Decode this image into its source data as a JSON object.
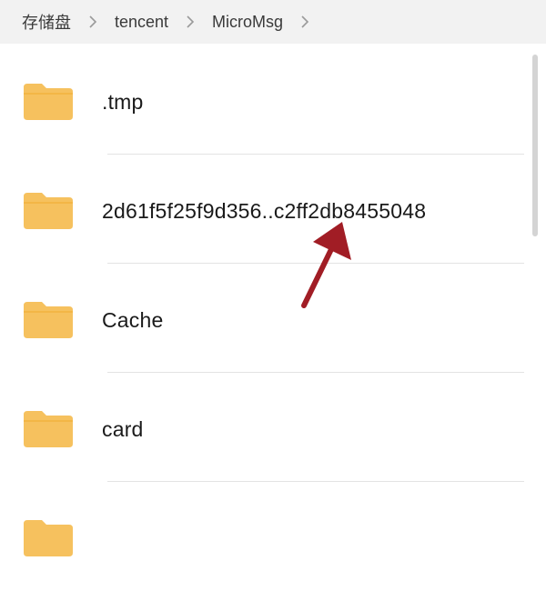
{
  "breadcrumb": {
    "items": [
      {
        "label": "存储盘"
      },
      {
        "label": "tencent"
      },
      {
        "label": "MicroMsg"
      }
    ]
  },
  "folders": [
    {
      "name": ".tmp",
      "icon": "folder-icon"
    },
    {
      "name": "2d61f5f25f9d356..c2ff2db8455048",
      "icon": "folder-icon"
    },
    {
      "name": "Cache",
      "icon": "folder-icon"
    },
    {
      "name": "card",
      "icon": "folder-icon"
    }
  ],
  "colors": {
    "folder": "#f6c15e",
    "folder_tab": "#f3b646",
    "arrow": "#a11d25",
    "breadcrumb_bg": "#f2f2f2"
  }
}
